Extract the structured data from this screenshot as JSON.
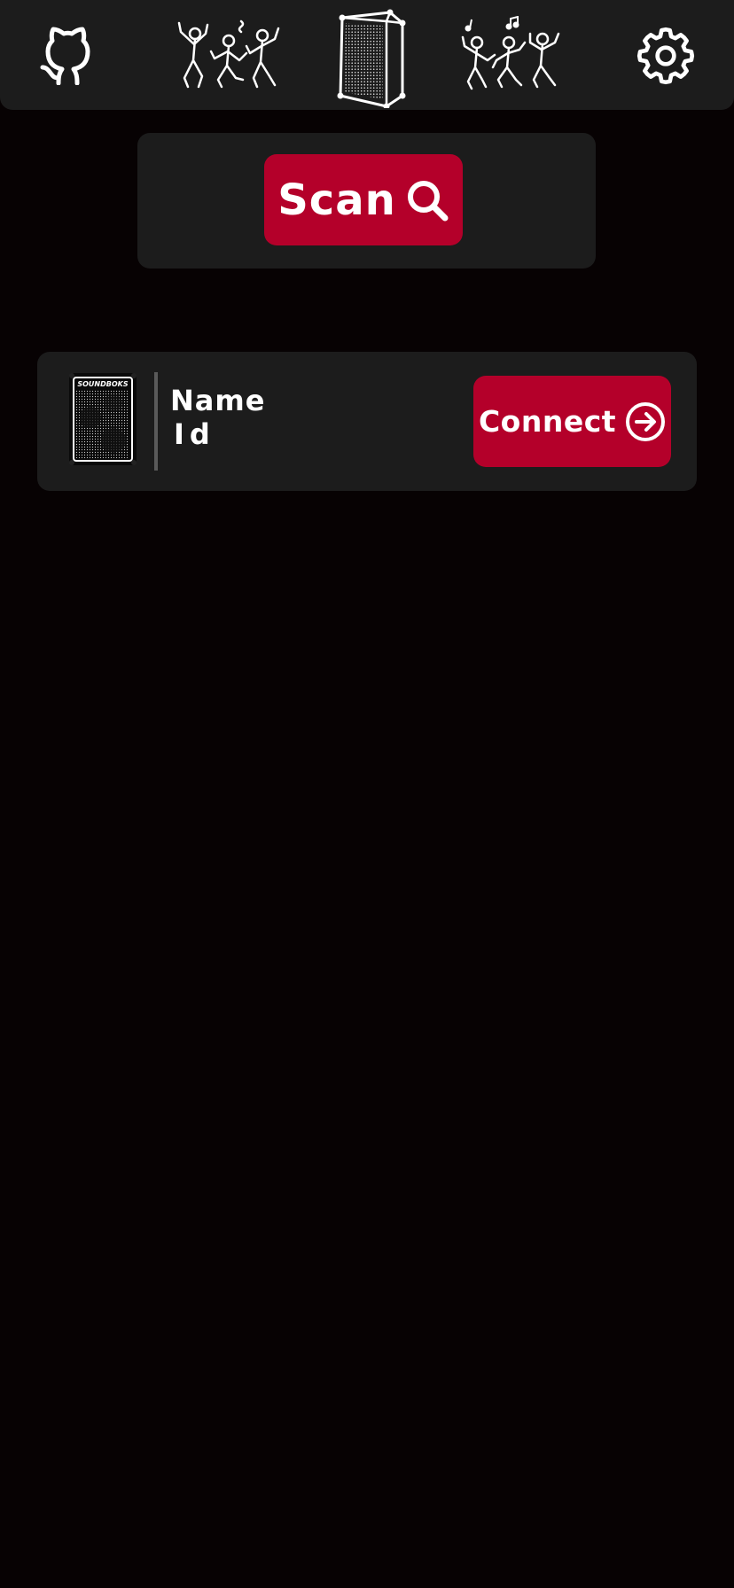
{
  "header": {
    "icons": {
      "github": "github-icon",
      "dancers_left": "dancing-people-icon",
      "speaker": "speaker-icon",
      "dancers_right": "dancing-people-music-icon",
      "settings": "gear-icon"
    }
  },
  "scan": {
    "label": "Scan",
    "icon": "search-icon"
  },
  "devices": [
    {
      "name": "Name",
      "id": "Id",
      "image_brand_text": "SOUNDBOKS",
      "connect_label": "Connect",
      "connect_icon": "arrow-right-circle-icon"
    }
  ],
  "colors": {
    "background": "#070203",
    "panel": "#1c1c1c",
    "accent": "#b4002a",
    "divider": "#5a5a5a",
    "text": "#ffffff"
  }
}
